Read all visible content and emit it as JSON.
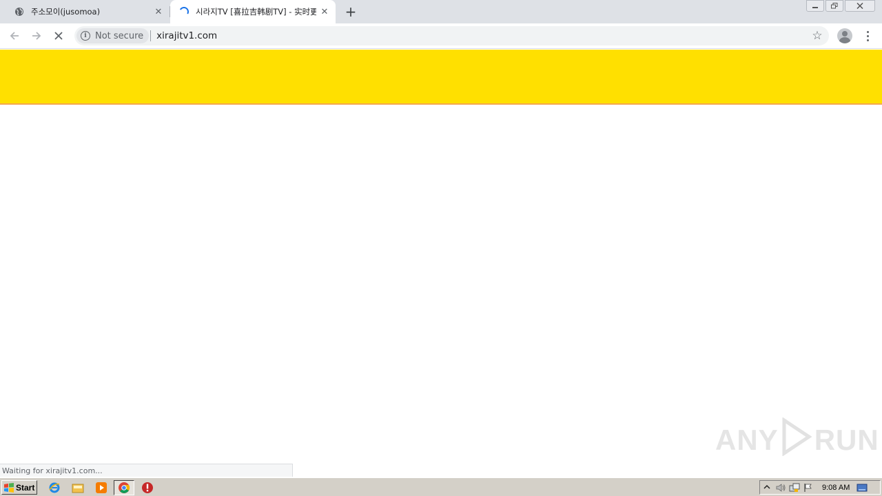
{
  "browser": {
    "tabs": [
      {
        "title": "주소모이(jusomoa)",
        "active": false
      },
      {
        "title": "시라지TV [喜拉吉韩剧TV] - 实时更新",
        "active": true
      }
    ],
    "security_label": "Not secure",
    "url": "xirajitv1.com",
    "status_text": "Waiting for xirajitv1.com..."
  },
  "page": {
    "banner_color": "#ffe000"
  },
  "watermark": {
    "left": "ANY",
    "right": "RUN"
  },
  "taskbar": {
    "start_label": "Start",
    "clock": "9:08 AM"
  }
}
